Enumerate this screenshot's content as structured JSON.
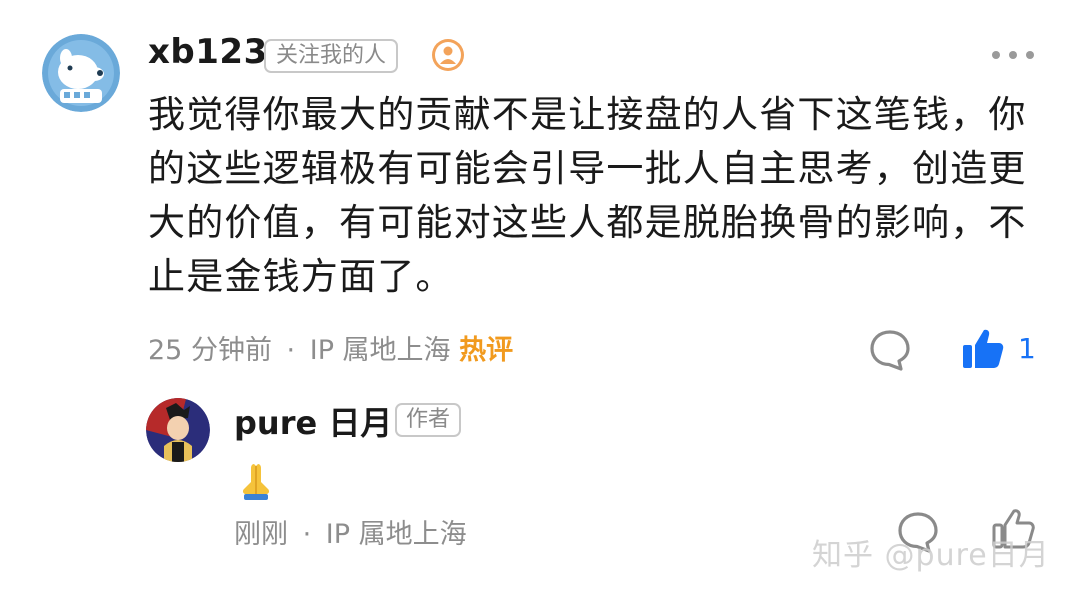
{
  "comment": {
    "username": "xb123",
    "follow_badge": "关注我的人",
    "text": "我觉得你最大的贡献不是让接盘的人省下这笔钱，你的这些逻辑极有可能会引导一批人自主思考，创造更大的价值，有可能对这些人都是脱胎换骨的影响，不止是金钱方面了。",
    "time": "25 分钟前",
    "separator": "·",
    "ip": "IP 属地上海",
    "hot_label": "热评",
    "like_count": "1",
    "icons": {
      "avatar": "dog-avatar",
      "badge": "user-badge-icon",
      "more": "more-icon",
      "reply": "comment-bubble-icon",
      "like": "thumbs-up-icon"
    }
  },
  "reply": {
    "username": "pure 日月",
    "author_badge": "作者",
    "text": "🙏",
    "time": "刚刚",
    "separator": "·",
    "ip": "IP 属地上海",
    "icons": {
      "avatar": "anime-avatar",
      "reply": "comment-bubble-icon",
      "like": "thumbs-up-outline-icon"
    }
  },
  "watermark": "知乎 @pure日月",
  "colors": {
    "accent": "#1772f6",
    "hot": "#f19a1e",
    "meta": "#8d8d8d",
    "text": "#1a1a1a",
    "badge_border": "#c8c8c8"
  }
}
